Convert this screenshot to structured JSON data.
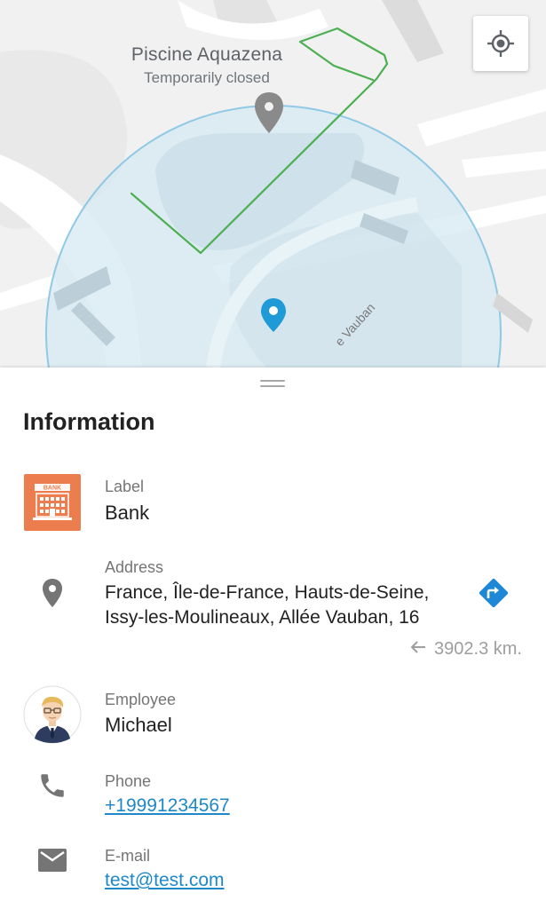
{
  "map": {
    "poi_name": "Piscine Aquazena",
    "poi_status": "Temporarily closed",
    "street_label": "e Vauban",
    "locate_button_icon": "my-location-icon",
    "colors": {
      "background": "#f1f1f1",
      "radius_fill": "#d6e9f2",
      "radius_stroke": "#8fc9e6",
      "route": "#4caf50",
      "pin_grey": "#8a8a8a",
      "pin_blue": "#1e9ad6"
    }
  },
  "sheet": {
    "title": "Information",
    "label": {
      "caption": "Label",
      "value": "Bank",
      "icon": "bank-icon"
    },
    "address": {
      "caption": "Address",
      "line1": "France, Île-de-France, Hauts-de-Seine,",
      "line2": "Issy-les-Moulineaux, Allée Vauban, 16",
      "distance": "3902.3 km.",
      "icon": "location-pin-icon",
      "route_icon": "directions-icon"
    },
    "employee": {
      "caption": "Employee",
      "value": "Michael",
      "icon": "avatar"
    },
    "phone": {
      "caption": "Phone",
      "value": "+19991234567",
      "icon": "phone-icon"
    },
    "email": {
      "caption": "E-mail",
      "value": "test@test.com",
      "icon": "mail-icon"
    },
    "colors": {
      "link": "#1e88c8",
      "accent_orange": "#ec7d4e",
      "accent_blue": "#1e88d6"
    }
  }
}
